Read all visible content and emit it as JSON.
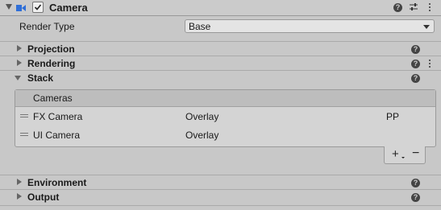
{
  "header": {
    "title": "Camera",
    "enabled": true
  },
  "render_type": {
    "label": "Render Type",
    "value": "Base"
  },
  "sections": {
    "projection": "Projection",
    "rendering": "Rendering",
    "stack": "Stack",
    "environment": "Environment",
    "output": "Output"
  },
  "stack_list": {
    "header": "Cameras",
    "rows": [
      {
        "name": "FX Camera",
        "type": "Overlay",
        "extra": "PP"
      },
      {
        "name": "UI Camera",
        "type": "Overlay",
        "extra": ""
      }
    ],
    "add_label": "+",
    "remove_label": "−"
  },
  "colors": {
    "camera_icon": "#2f6fd8",
    "panel_bg": "#c8c8c8"
  }
}
